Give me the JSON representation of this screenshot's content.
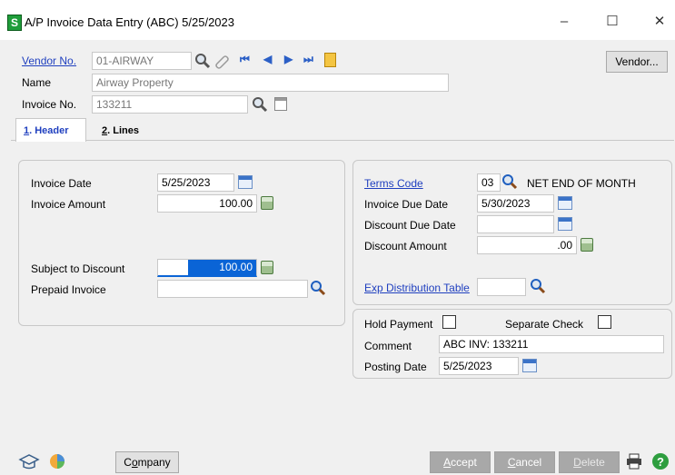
{
  "window": {
    "title": "A/P Invoice Data Entry (ABC) 5/25/2023",
    "app_icon_letter": "S",
    "controls": [
      "minimize-icon",
      "maximize-icon",
      "close-icon"
    ]
  },
  "top": {
    "vendor_no_label": "Vendor No.",
    "vendor_no_value": "01-AIRWAY",
    "name_label": "Name",
    "name_value": "Airway Property",
    "invoice_no_label": "Invoice No.",
    "invoice_no_value": "133211",
    "vendor_button": "Vendor..."
  },
  "tabs": [
    {
      "key": "1",
      "label": ". Header",
      "active": true
    },
    {
      "key": "2",
      "label": ". Lines",
      "active": false
    }
  ],
  "left_panel": {
    "invoice_date_label": "Invoice Date",
    "invoice_date_value": "5/25/2023",
    "invoice_amount_label": "Invoice Amount",
    "invoice_amount_value": "100.00",
    "subject_discount_label": "Subject to Discount",
    "subject_discount_value": "100.00",
    "prepaid_invoice_label": "Prepaid Invoice",
    "prepaid_invoice_value": ""
  },
  "right_panel": {
    "terms_code_label": "Terms Code",
    "terms_code_value": "03",
    "terms_description": "NET END OF MONTH",
    "invoice_due_date_label": "Invoice Due Date",
    "invoice_due_date_value": "5/30/2023",
    "discount_due_date_label": "Discount Due Date",
    "discount_due_date_value": "",
    "discount_amount_label": "Discount Amount",
    "discount_amount_value": ".00",
    "exp_distribution_label": "Exp Distribution Table",
    "exp_distribution_value": ""
  },
  "lower_right_panel": {
    "hold_payment_label": "Hold Payment",
    "hold_payment_checked": false,
    "separate_check_label": "Separate Check",
    "separate_check_checked": false,
    "comment_label": "Comment",
    "comment_value": "ABC INV: 133211",
    "posting_date_label": "Posting Date",
    "posting_date_value": "5/25/2023"
  },
  "footer": {
    "company_button": {
      "pre": "C",
      "hotkey": "o",
      "post": "mpany"
    },
    "accept_button": {
      "hotkey": "A",
      "post": "ccept"
    },
    "cancel_button": {
      "hotkey": "C",
      "post": "ancel"
    },
    "delete_button": {
      "hotkey": "D",
      "post": "elete"
    }
  },
  "colors": {
    "link": "#1f3fbf",
    "selected_field": "#0a64d6",
    "app_icon": "#1f9d3a"
  }
}
